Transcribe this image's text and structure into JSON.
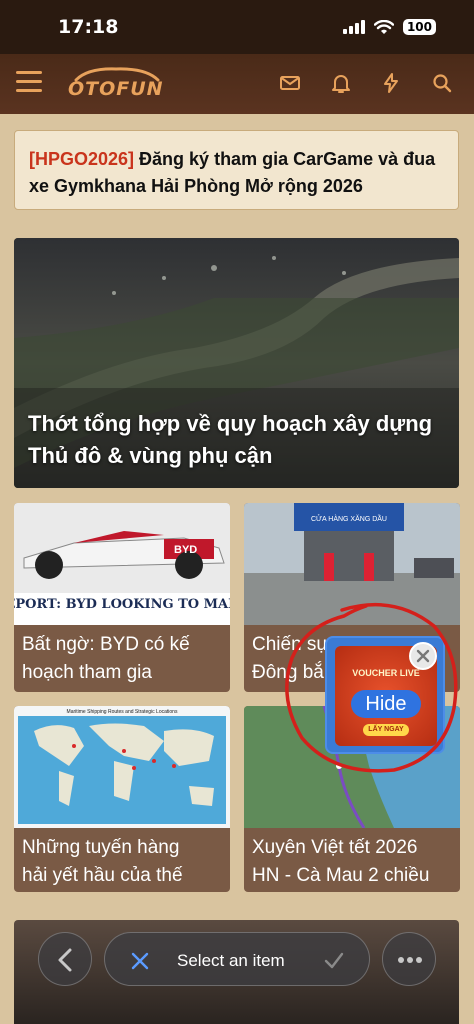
{
  "status": {
    "time": "17:18",
    "battery": "100"
  },
  "header": {
    "logo_text": "OTOFUN",
    "colors": {
      "accent": "#e8a25c",
      "bg": "#4a2a18"
    }
  },
  "notice": {
    "tag": "[HPGO2026]",
    "text": " Đăng ký tham gia CarGame và đua xe Gymkhana Hải Phòng Mở rộng 2026"
  },
  "hero": {
    "title": "Thớt tổng hợp về quy hoạch xây dựng Thủ đô & vùng phụ cận"
  },
  "cards": [
    {
      "title_line1": "Bất ngờ: BYD có kế",
      "title_line2": "hoạch tham gia",
      "img_caption": "REPORT: BYD LOOKING TO MAKE",
      "img_badge": "BYD"
    },
    {
      "title_line1": "Chiến sự",
      "title_line2": "Đông bắ",
      "img_sign": "CỬA HÀNG XĂNG DẦU"
    },
    {
      "title_line1": "Những tuyến hàng",
      "title_line2": "hải yết hầu của thế",
      "img_caption": "Maritime Shipping Routes and Strategic Locations"
    },
    {
      "title_line1": "Xuyên Việt tết 2026",
      "title_line2": "HN - Cà Mau 2 chiều"
    }
  ],
  "popup": {
    "voucher_label": "VOUCHER LIVE",
    "hide_label": "Hide",
    "button_label": "LẤY NGAY"
  },
  "bottom_bar": {
    "prompt": "Select an item"
  }
}
